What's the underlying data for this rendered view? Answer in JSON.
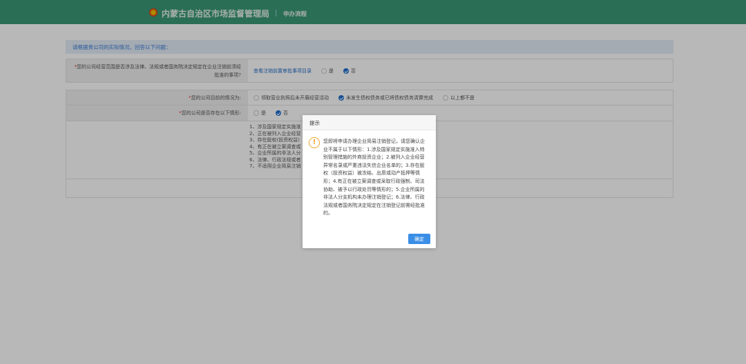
{
  "header": {
    "title": "内蒙古自治区市场监督管理局",
    "subtitle": "申办流程"
  },
  "intro": "请根据贵公司的实际情况，回答以下问题：",
  "q1": {
    "required": "*",
    "label": "您的公司经营范围是否涉及法律、法规或者国务院决定规定在企业注销前须经批准的事项?",
    "link": "查看注销前置审批事项目录",
    "options": [
      "是",
      "否"
    ],
    "selected": 1
  },
  "q2": {
    "required": "*",
    "label": "您的公司目前的情况为:",
    "options": [
      "领取营业执照后未开展经营活动",
      "未发生债权债务或已将债权债务清算完成",
      "以上都不是"
    ],
    "selected": 1
  },
  "q3": {
    "required": "*",
    "label": "您的公司是否存在以下情形:",
    "options": [
      "是",
      "否"
    ],
    "selected": 1
  },
  "list": [
    "1、涉及国家规定实施准",
    "2、正在被列入企业经营",
    "3、存在股权(投资权益)",
    "4、有正在被立案调查或",
    "5、企业所属的非法人分",
    "6、法律、行政法规或者",
    "7、不适用企业简易注销"
  ],
  "modal": {
    "title": "提示",
    "message": "您即将申请办理企业简易注销登记，请您确认企业不属于以下情形：1.涉及国家规定实施准入特别管理措施的外商投资企业；2.被列入企业经营异常名录或严重违法失信企业名单的；3.存在股权（投资权益）被冻结、出质或动产抵押等情形；4.有正在被立案调查或采取行政强制、司法协助、被予以行政处罚等情形的；5.企业所属的非法人分支机构未办理注销登记；6.法律、行政法规或者国务院决定规定在注销登记前需经批准的。",
    "confirm": "确定"
  },
  "colors": {
    "header": "#3a9976",
    "primary": "#3a8ee6",
    "warning": "#f2a32a"
  }
}
